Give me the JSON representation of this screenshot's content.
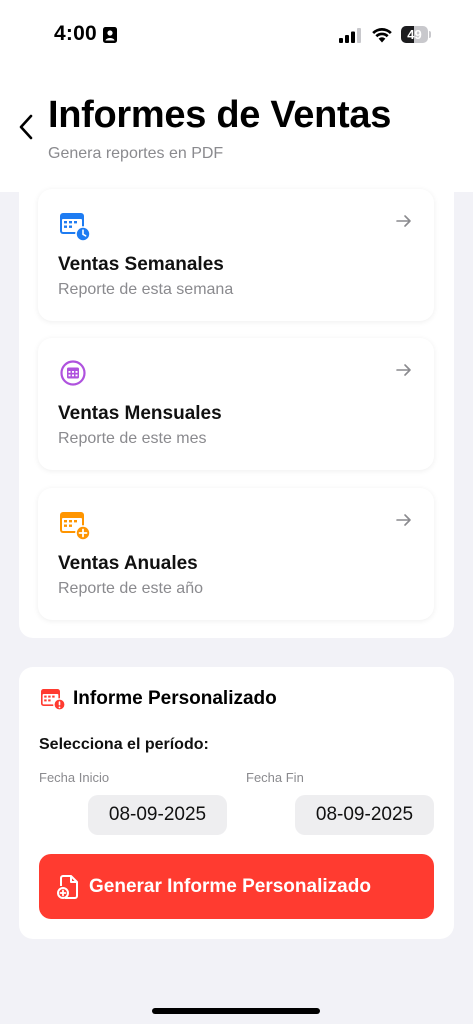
{
  "status_bar": {
    "time": "4:00",
    "battery_level": 49,
    "battery_text": "49"
  },
  "header": {
    "title": "Informes de Ventas",
    "subtitle": "Genera reportes en PDF"
  },
  "reports": [
    {
      "title": "Ventas Semanales",
      "subtitle": "Reporte de esta semana",
      "icon": "calendar-clock-icon",
      "color": "#1e7cf2"
    },
    {
      "title": "Ventas Mensuales",
      "subtitle": "Reporte de este mes",
      "icon": "calendar-circle-icon",
      "color": "#af52de"
    },
    {
      "title": "Ventas Anuales",
      "subtitle": "Reporte de este año",
      "icon": "calendar-plus-icon",
      "color": "#ff9500"
    }
  ],
  "custom_report": {
    "title": "Informe Personalizado",
    "period_label": "Selecciona el período:",
    "start_label": "Fecha Inicio",
    "start_value": "08-09-2025",
    "end_label": "Fecha Fin",
    "end_value": "08-09-2025",
    "button_label": "Generar Informe Personalizado",
    "accent_color": "#ff3b30"
  }
}
